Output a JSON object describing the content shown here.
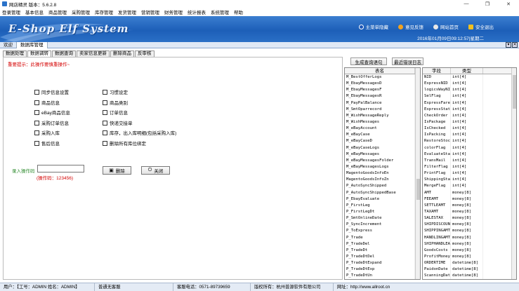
{
  "window": {
    "title": "网店精灵  版本：5.6.2.8",
    "minimize": "—",
    "maximize": "❐",
    "close": "✕"
  },
  "menu": [
    "登录管理",
    "基本信息",
    "商品管理",
    "采购管理",
    "库存管理",
    "发货管理",
    "营销管理",
    "财务管理",
    "统计报表",
    "系统管理",
    "帮助"
  ],
  "banner": {
    "logo": "E-Shop Elf System",
    "links": [
      {
        "label": "主菜单隐藏",
        "color": "#1b54b5"
      },
      {
        "label": "意见反馈",
        "color": "#f2a21f"
      },
      {
        "label": "网站首页",
        "color": "#e8e8e8"
      },
      {
        "label": "安全退出",
        "color": "#f2c01f"
      }
    ],
    "datetime": "2016年01月09日09:12:57|星期二"
  },
  "main_tabs": [
    "欢迎",
    "数据库管理"
  ],
  "sub_tabs": [
    "数据处理",
    "数据调转",
    "数据查询",
    "卖家信息更新",
    "删除商品",
    "反审核"
  ],
  "hint": "重要提示：此操作要慎重操作~",
  "checkboxes_left": [
    "同步信息设置",
    "商品信息",
    "eBay商品信息",
    "采购订单信息",
    "采购入库",
    "售后信息"
  ],
  "checkboxes_right": [
    "习惯设定",
    "商品类别",
    "订单信息",
    "快递交接单",
    "库存，出入库明细(包括采购入库)",
    "删除所有库位绑定"
  ],
  "op": {
    "label": "录入操作码",
    "value": "",
    "hint": "(操作码：123456)"
  },
  "buttons": {
    "delete": "删除",
    "close": "关闭",
    "gen_query": "生成查询语句",
    "recent_log": "最近错误日志"
  },
  "tables_list": {
    "header": "表名",
    "rows": [
      "M_BestOfferLogs",
      "M_EbayMessagesD",
      "M_EbayMessagesF",
      "M_EbayMessagesR",
      "M_PayPalBalance",
      "M_SmtOparrecord",
      "M_WishMessageReply",
      "M_WishMessages",
      "M_eBayAccount",
      "M_eBayCase",
      "M_eBayCaseD",
      "M_eBayCaseLogs",
      "M_eBayMessages",
      "M_eBayMessagesFolder",
      "M_eBayMessagesLogs",
      "MagentoGoodsInfoEn",
      "MagentoGoodsInfoZn",
      "P_AutoSyncShipped",
      "P_AutoSyncShippedBase",
      "P_EbayEvaluate",
      "P_FirstLeg",
      "P_FirstLegDt",
      "P_SmtOnlineDate",
      "P_SyncIncrement",
      "P_ToExpress",
      "P_Trade",
      "P_TradeDel",
      "P_TradeDt",
      "P_TradeDtDel",
      "P_TradeDtExpand",
      "P_TradeDtExp",
      "P_TradeDtUn"
    ]
  },
  "fields_list": {
    "header_field": "字段",
    "header_type": "类型",
    "rows": [
      [
        "NID",
        "int[4]"
      ],
      [
        "ExpressNID",
        "int[4]"
      ],
      [
        "logicsWayNI",
        "int[4]"
      ],
      [
        "SelFlag",
        "int[4]"
      ],
      [
        "ExpressFare",
        "int[4]"
      ],
      [
        "ExpressStat",
        "int[4]"
      ],
      [
        "CheckOrder",
        "int[4]"
      ],
      [
        "IsPackage",
        "int[4]"
      ],
      [
        "IsChecked",
        "int[4]"
      ],
      [
        "IsPacking",
        "int[4]"
      ],
      [
        "RestoreStoc",
        "int[4]"
      ],
      [
        "colorFlag",
        "int[4]"
      ],
      [
        "EvaluateSta",
        "int[4]"
      ],
      [
        "TransMail",
        "int[4]"
      ],
      [
        "FilterFlag",
        "int[4]"
      ],
      [
        "PrintFlag",
        "int[4]"
      ],
      [
        "ShippingSta",
        "int[4]"
      ],
      [
        "MergeFlag",
        "int[4]"
      ],
      [
        "AMT",
        "money[8]"
      ],
      [
        "FEEAMT",
        "money[8]"
      ],
      [
        "SETTLEAMT",
        "money[8]"
      ],
      [
        "TAXAMT",
        "money[8]"
      ],
      [
        "SALESTAX",
        "money[8]"
      ],
      [
        "SHIPDISCOUN",
        "money[8]"
      ],
      [
        "SHIPPINGAMT",
        "money[8]"
      ],
      [
        "HANDLINGAMT",
        "money[8]"
      ],
      [
        "SHIPHANDLEA",
        "money[8]"
      ],
      [
        "GoodsCosts",
        "money[8]"
      ],
      [
        "ProfitMoney",
        "money[8]"
      ],
      [
        "ORDERTIME",
        "datetime[8]"
      ],
      [
        "PaidonDate",
        "datetime[8]"
      ],
      [
        "ScanningDat",
        "datetime[8]"
      ]
    ]
  },
  "status": {
    "user": "用户：【工号：ADMIN  姓名：ADMIN】",
    "service": "普通无客服",
    "phone": "客服电话：0571-89739659",
    "copyright": "版权所有：杭州普源软件有限公司",
    "site": "网址：http://www.allroot.cn"
  }
}
